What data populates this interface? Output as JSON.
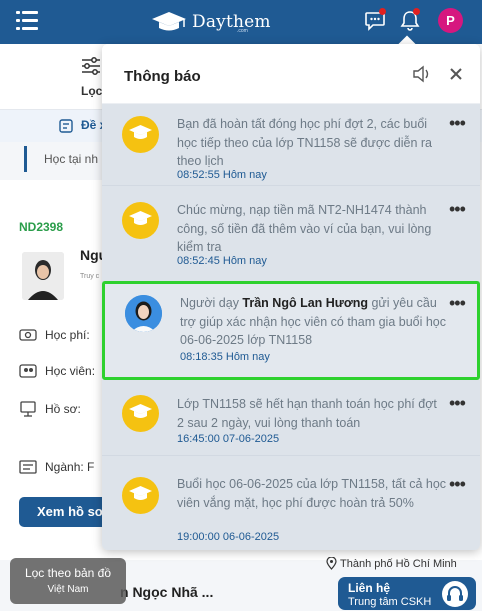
{
  "header": {
    "logo_text": "Daythem",
    "logo_sub": ".com",
    "avatar_initial": "P"
  },
  "background": {
    "filter_label": "Lọc",
    "subtab_label": "Đề x",
    "search_text": "Học tại nh",
    "code": "ND2398",
    "name": "Ngu",
    "small": "Truy c",
    "fields": [
      "Học phí:",
      "Học viên:",
      "Hồ sơ:",
      "Ngành:  F"
    ],
    "view_button": "Xem hồ sơ",
    "bottom_name": "n Ngọc Nhã ...",
    "map_chip_line1": "Lọc theo bản đồ",
    "map_chip_line2": "Việt Nam",
    "location": "Thành phố Hồ Chí Minh",
    "support_line1": "Liên hệ",
    "support_line2": "Trung tâm CSKH"
  },
  "panel": {
    "title": "Thông báo",
    "items": [
      {
        "type": "system",
        "text": "Bạn đã hoàn tất đóng học phí đợt 2, các buổi học tiếp theo của lớp TN1158 sẽ được diễn ra theo lịch",
        "time": "08:52:55 Hôm nay"
      },
      {
        "type": "system",
        "text": "Chúc mừng, nạp tiền mã NT2-NH1474 thành công, số tiền đã thêm vào ví của bạn, vui lòng kiểm tra",
        "time": "08:52:45 Hôm nay"
      },
      {
        "type": "user",
        "prefix": "Người dạy ",
        "bold_name": "Trần Ngô Lan Hương",
        "suffix": " gửi yêu cầu trợ giúp xác nhận học viên có tham gia buổi học 06-06-2025 lớp TN1158",
        "time": "08:18:35 Hôm nay",
        "highlighted": true
      },
      {
        "type": "system",
        "text": "Lớp TN1158 sẽ hết hạn thanh toán học phí đợt 2 sau 2 ngày, vui lòng thanh toán",
        "time": "16:45:00 07-06-2025"
      },
      {
        "type": "system",
        "text": "Buổi học 06-06-2025 của lớp TN1158, tất cả học viên vắng mặt, học phí được hoàn trả 50%",
        "time": "19:00:00 06-06-2025"
      }
    ]
  },
  "colors": {
    "brand": "#1f5a93",
    "highlight_border": "#2ed12e",
    "icon_yellow": "#f5c211",
    "alert_dot": "#e02020"
  },
  "icons": [
    "menu-icon",
    "graduation-cap-icon",
    "chat-icon",
    "bell-icon",
    "speaker-icon",
    "close-icon",
    "more-icon",
    "location-pin-icon",
    "headset-icon"
  ]
}
